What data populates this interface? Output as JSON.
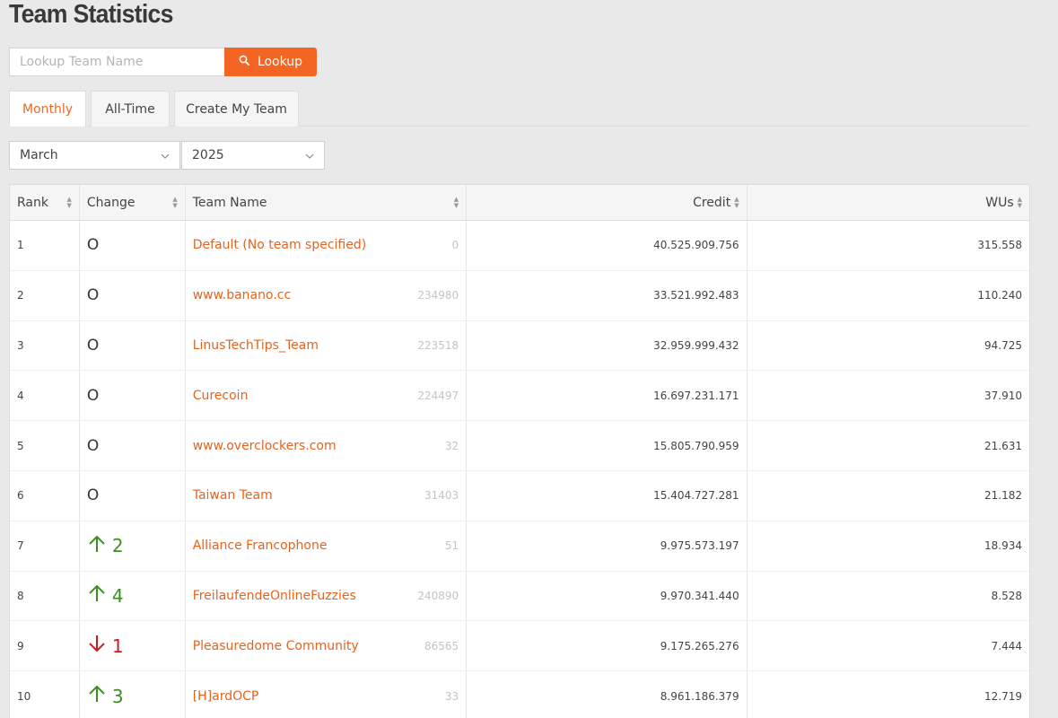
{
  "page_title": "Team Statistics",
  "search": {
    "placeholder": "Lookup Team Name",
    "button_label": "Lookup"
  },
  "tabs": [
    {
      "label": "Monthly",
      "active": true
    },
    {
      "label": "All-Time",
      "active": false
    },
    {
      "label": "Create My Team",
      "active": false
    }
  ],
  "filters": {
    "month": "March",
    "year": "2025"
  },
  "table": {
    "headers": {
      "rank": "Rank",
      "change": "Change",
      "team": "Team Name",
      "credit": "Credit",
      "wus": "WUs"
    },
    "rows": [
      {
        "rank": "1",
        "change_dir": "none",
        "change": "O",
        "team": "Default (No team specified)",
        "id": "0",
        "credit": "40.525.909.756",
        "wus": "315.558"
      },
      {
        "rank": "2",
        "change_dir": "none",
        "change": "O",
        "team": "www.banano.cc",
        "id": "234980",
        "credit": "33.521.992.483",
        "wus": "110.240"
      },
      {
        "rank": "3",
        "change_dir": "none",
        "change": "O",
        "team": "LinusTechTips_Team",
        "id": "223518",
        "credit": "32.959.999.432",
        "wus": "94.725"
      },
      {
        "rank": "4",
        "change_dir": "none",
        "change": "O",
        "team": "Curecoin",
        "id": "224497",
        "credit": "16.697.231.171",
        "wus": "37.910"
      },
      {
        "rank": "5",
        "change_dir": "none",
        "change": "O",
        "team": "www.overclockers.com",
        "id": "32",
        "credit": "15.805.790.959",
        "wus": "21.631"
      },
      {
        "rank": "6",
        "change_dir": "none",
        "change": "O",
        "team": "Taiwan Team",
        "id": "31403",
        "credit": "15.404.727.281",
        "wus": "21.182"
      },
      {
        "rank": "7",
        "change_dir": "up",
        "change": "2",
        "team": "Alliance Francophone",
        "id": "51",
        "credit": "9.975.573.197",
        "wus": "18.934"
      },
      {
        "rank": "8",
        "change_dir": "up",
        "change": "4",
        "team": "FreilaufendeOnlineFuzzies",
        "id": "240890",
        "credit": "9.970.341.440",
        "wus": "8.528"
      },
      {
        "rank": "9",
        "change_dir": "down",
        "change": "1",
        "team": "Pleasuredome Community",
        "id": "86565",
        "credit": "9.175.265.276",
        "wus": "7.444"
      },
      {
        "rank": "10",
        "change_dir": "up",
        "change": "3",
        "team": "[H]ardOCP",
        "id": "33",
        "credit": "8.961.186.379",
        "wus": "12.719"
      }
    ]
  },
  "colors": {
    "accent": "#f26522",
    "up": "#3a8f1e",
    "down": "#cc1d1d"
  }
}
